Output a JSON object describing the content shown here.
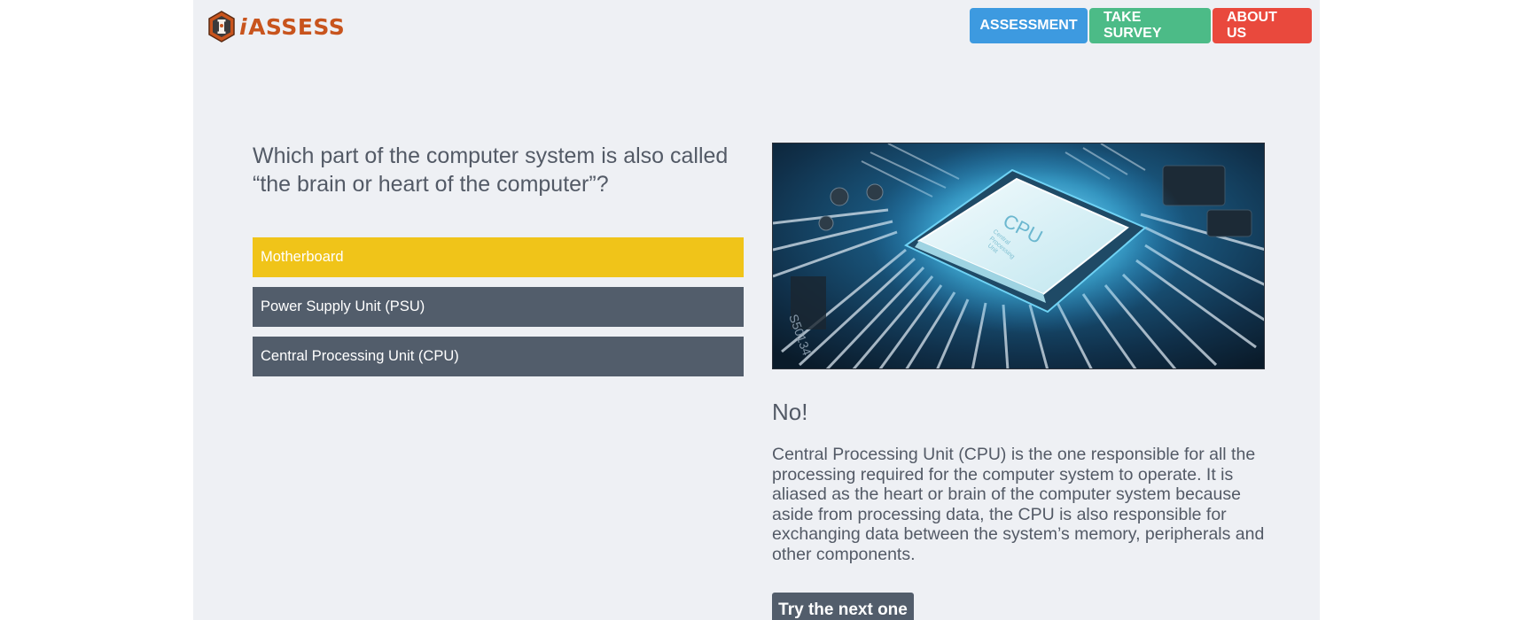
{
  "header": {
    "logo_text": "iASSESS",
    "logo_prefix": "i",
    "logo_main": "ASSESS",
    "nav": [
      {
        "label": "ASSESSMENT",
        "color": "#3d9ae0"
      },
      {
        "label": "TAKE SURVEY",
        "color": "#4cbb87"
      },
      {
        "label": "ABOUT US",
        "color": "#e9493d"
      }
    ]
  },
  "quiz": {
    "question": "Which part of the computer system is also called “the brain or heart of the computer”?",
    "options": [
      {
        "label": "Motherboard",
        "state": "selected",
        "color": "#f0c419"
      },
      {
        "label": "Power Supply Unit (PSU)",
        "state": "default",
        "color": "#525d6b"
      },
      {
        "label": "Central Processing Unit (CPU)",
        "state": "default",
        "color": "#525d6b"
      }
    ],
    "image": {
      "icon": "cpu-chip-image",
      "chip_label": "CPU",
      "chip_sublabel_1": "Central",
      "chip_sublabel_2": "Processing",
      "chip_sublabel_3": "Unit",
      "board_code": "S50134"
    },
    "result": "No!",
    "explanation": "Central Processing Unit (CPU) is the one responsible for all the processing required for the computer system to operate. It is aliased as the heart or brain of the computer system because aside from processing data, the CPU is also responsible for exchanging data between the system’s memory, peripherals and other components.",
    "next_label": "Try the next one"
  }
}
